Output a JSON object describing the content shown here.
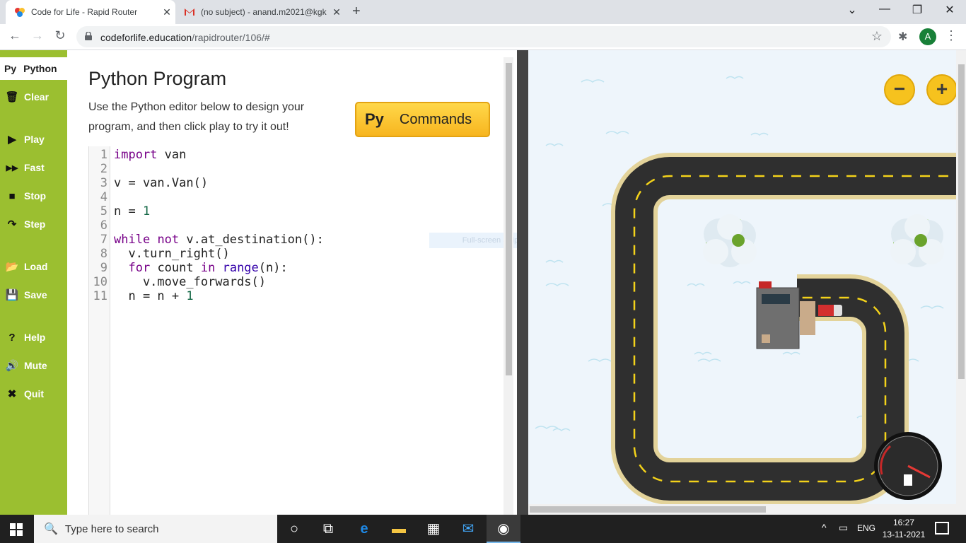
{
  "browser": {
    "tabs": [
      {
        "title": "Code for Life - Rapid Router",
        "close": "✕"
      },
      {
        "title": "(no subject) - anand.m2021@kgk",
        "close": "✕"
      }
    ],
    "new_tab": "+",
    "window_controls": {
      "dropdown": "⌄",
      "minimize": "—",
      "restore": "❐",
      "close": "✕"
    },
    "url_host": "codeforlife.education",
    "url_path": "/rapidrouter/106/#",
    "avatar_letter": "A"
  },
  "sidebar": {
    "tab_label": "Python",
    "tab_icon": "Py",
    "buttons": [
      {
        "label": "Clear",
        "icon": "trash-icon"
      },
      {
        "label": "Play",
        "icon": "play-icon"
      },
      {
        "label": "Fast",
        "icon": "fast-forward-icon"
      },
      {
        "label": "Stop",
        "icon": "stop-icon"
      },
      {
        "label": "Step",
        "icon": "step-icon"
      },
      {
        "label": "Load",
        "icon": "folder-icon"
      },
      {
        "label": "Save",
        "icon": "save-icon"
      },
      {
        "label": "Help",
        "icon": "help-icon"
      },
      {
        "label": "Mute",
        "icon": "speaker-icon"
      },
      {
        "label": "Quit",
        "icon": "close-icon"
      }
    ]
  },
  "editor": {
    "title": "Python Program",
    "description": "Use the Python editor below to design your program, and then click play to try it out!",
    "commands_button": {
      "icon": "Py",
      "label": "Commands"
    },
    "line_numbers": [
      "1",
      "2",
      "3",
      "4",
      "5",
      "6",
      "7",
      "8",
      "9",
      "10",
      "11"
    ],
    "code_lines": [
      "import van",
      "",
      "v = van.Van()",
      "",
      "n = 1",
      "",
      "while not v.at_destination():",
      "  v.turn_right()",
      "  for count in range(n):",
      "    v.move_forwards()",
      "  n = n + 1"
    ],
    "overlay_text": "Full-screen Snip"
  },
  "game": {
    "zoom_out": "−",
    "zoom_in": "+"
  },
  "taskbar": {
    "search_placeholder": "Type here to search",
    "language": "ENG",
    "time": "16:27",
    "date": "13-11-2021"
  },
  "colors": {
    "sidebar": "#9bbf30",
    "commands_button": "#f7b51f",
    "road": "#2f2f2f",
    "road_border": "#e3d39a",
    "zoom_buttons": "#f6c21e",
    "keyword": "#770088"
  }
}
